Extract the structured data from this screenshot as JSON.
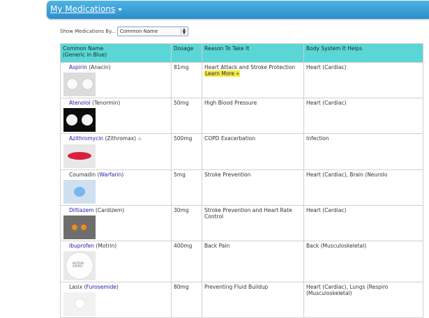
{
  "header": {
    "title": "My Medications"
  },
  "filter": {
    "label": "Show Medications By...",
    "value": "Common Name"
  },
  "table": {
    "columns": [
      "Common Name\n(Generic in Blue)",
      "Dosage",
      "Reason To Take It",
      "Body System It Helps"
    ],
    "col1_line1": "Common Name",
    "col1_line2": "(Generic in Blue)",
    "rows": [
      {
        "name": "Aspirin",
        "alt": "(Anacin)",
        "dosage": "81mg",
        "reason": "Heart Attack and Stroke Protection",
        "learn_more": "Learn More »",
        "system": "Heart (Cardiac)",
        "image": "white-round-pills"
      },
      {
        "name": "Atenolol",
        "alt": "(Tenormin)",
        "dosage": "50mg",
        "reason": "High Blood Pressure",
        "system": "Heart (Cardiac)",
        "image": "white-pills-on-black"
      },
      {
        "name": "Azithromycin",
        "alt": "(Zithromax)",
        "warning": "⚠",
        "dosage": "500mg",
        "reason": "COPD Exacerbation",
        "system": "Infection",
        "image": "red-oval-pill"
      },
      {
        "name": "Coumadin",
        "alt_open": "(",
        "alt_generic": "Warfarin",
        "alt_close": ")",
        "dosage": "5mg",
        "reason": "Stroke Prevention",
        "system": "Heart (Cardiac), Brain (Neurolo",
        "image": "blue-pill"
      },
      {
        "name": "Diltiazem",
        "alt": "(Cardizem)",
        "dosage": "30mg",
        "reason": "Stroke Prevention and Heart Rate Control",
        "system": "Heart (Cardiac)",
        "image": "orange-pills"
      },
      {
        "name": "Ibuprofen",
        "alt": "(Motrin)",
        "dosage": "400mg",
        "reason": "Back Pain",
        "system": "Back (Musculoskeletal)",
        "image": "white-imprinted-pill",
        "imprint": "MOTRIN\n400MG"
      },
      {
        "name": "Lasix",
        "alt_open": "(",
        "alt_generic": "Furosemide",
        "alt_close": ")",
        "dosage": "80mg",
        "reason": "Preventing Fluid Buildup",
        "system": "Heart (Cardiac), Lungs (Respiro\n(Musculoskeletal)",
        "system_line1": "Heart (Cardiac), Lungs (Respiro",
        "system_line2": "(Musculoskeletal)",
        "image": "white-small-pill"
      }
    ]
  },
  "colors": {
    "header": "#2a8fcb",
    "table_header": "#5ad6d6",
    "generic_link": "#1a1aa6",
    "highlight": "#f6ee2c"
  }
}
